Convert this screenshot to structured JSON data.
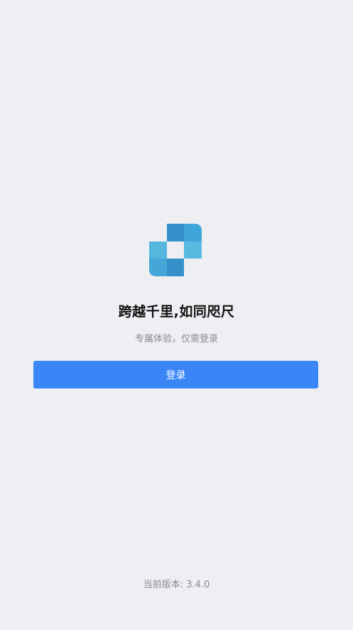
{
  "app": {
    "logo_icon": "blue-checker-logo-icon",
    "slogan": "跨越千里,如同咫尺",
    "subtitle": "专属体验，仅需登录"
  },
  "login": {
    "button_label": "登录"
  },
  "footer": {
    "version_label": "当前版本:",
    "version_value": "3.4.0"
  },
  "colors": {
    "background": "#eeeff3",
    "primary": "#3a86f7",
    "logo_dark": "#3a93cc",
    "logo_light": "#57b5de"
  }
}
